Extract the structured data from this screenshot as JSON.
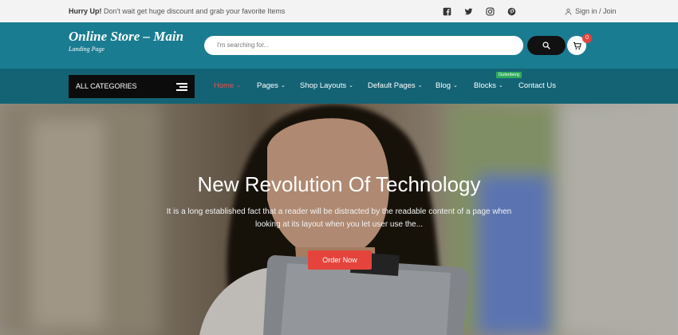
{
  "topbar": {
    "promo_strong": "Hurry Up!",
    "promo_text": " Don't wait get huge discount and grab your favorite Items",
    "social_icons": [
      "facebook-icon",
      "twitter-icon",
      "instagram-icon",
      "pinterest-icon"
    ],
    "signin_label": "Sign in / Join"
  },
  "header": {
    "brand_title": "Online Store – Main",
    "brand_subtitle": "Landing Page",
    "search_placeholder": "I'm searching for...",
    "cart_count": "0"
  },
  "nav": {
    "all_categories": "ALL CATEGORIES",
    "items": [
      {
        "label": "Home"
      },
      {
        "label": "Pages"
      },
      {
        "label": "Shop Layouts"
      },
      {
        "label": "Default Pages"
      },
      {
        "label": "Blog"
      },
      {
        "label": "Blocks"
      },
      {
        "label": "Contact Us"
      }
    ],
    "blocks_badge": "Gutenberg"
  },
  "hero": {
    "title": "New Revolution Of Technology",
    "text": "It is a long established fact that a reader will be distracted by the readable content of a page when looking at its layout when you let user use the...",
    "button_label": "Order Now"
  },
  "colors": {
    "header_bg": "#1a7c91",
    "nav_bg": "#146375",
    "accent_red": "#e4443c",
    "badge_green": "#2eac5b"
  }
}
